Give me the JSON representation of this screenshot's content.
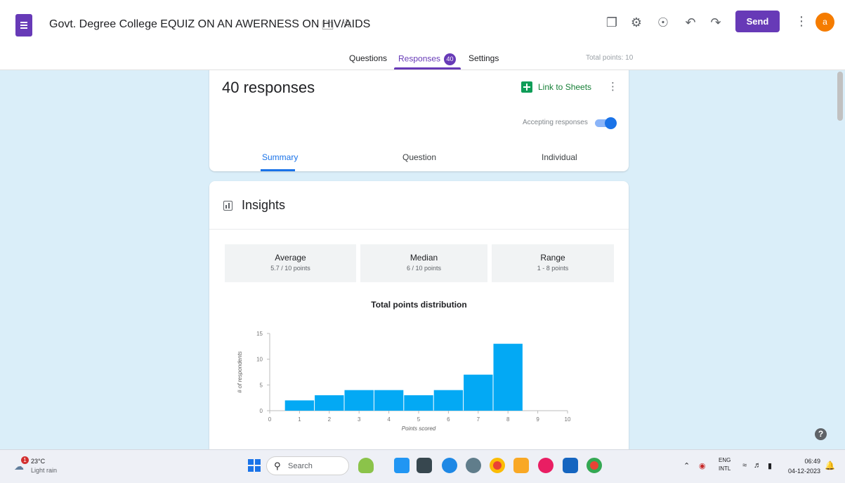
{
  "header": {
    "doc_title": "Govt. Degree College EQUIZ ON AN AWERNESS ON HIV/AIDS",
    "folder_icon": "folder-icon",
    "star_icon": "star-icon",
    "toolbar_icons": [
      "addons-icon",
      "palette-icon",
      "preview-eye-icon",
      "undo-icon",
      "redo-icon"
    ],
    "send_label": "Send",
    "avatar_initial": "a",
    "accent_color": "#673ab7"
  },
  "tabs": {
    "questions": "Questions",
    "responses": "Responses",
    "responses_count": "40",
    "settings": "Settings",
    "total_points": "Total points: 10"
  },
  "responses_card": {
    "count_label": "40 responses",
    "link_sheets": "Link to Sheets",
    "accepting_label": "Accepting responses",
    "accepting_on": true,
    "subtabs": [
      "Summary",
      "Question",
      "Individual"
    ],
    "active_subtab": "Summary"
  },
  "insights": {
    "title": "Insights",
    "stats": [
      {
        "label": "Average",
        "value": "5.7 / 10 points"
      },
      {
        "label": "Median",
        "value": "6 / 10 points"
      },
      {
        "label": "Range",
        "value": "1 - 8 points"
      }
    ]
  },
  "chart_data": {
    "type": "bar",
    "title": "Total points distribution",
    "xlabel": "Points scored",
    "ylabel": "# of respondents",
    "categories": [
      "1",
      "2",
      "3",
      "4",
      "5",
      "6",
      "7",
      "8"
    ],
    "values": [
      2,
      3,
      4,
      4,
      3,
      4,
      7,
      13
    ],
    "x_ticks": [
      "0",
      "1",
      "2",
      "3",
      "4",
      "5",
      "6",
      "7",
      "8",
      "9",
      "10"
    ],
    "y_ticks": [
      "0",
      "5",
      "10",
      "15"
    ],
    "ylim": [
      0,
      15
    ],
    "bar_color": "#03a9f4",
    "grid": false
  },
  "taskbar": {
    "weather_temp": "23°C",
    "weather_cond": "Light rain",
    "weather_alert": "1",
    "search_label": "Search",
    "lang_top": "ENG",
    "lang_bottom": "INTL",
    "time": "06:49",
    "date": "04-12-2023"
  }
}
